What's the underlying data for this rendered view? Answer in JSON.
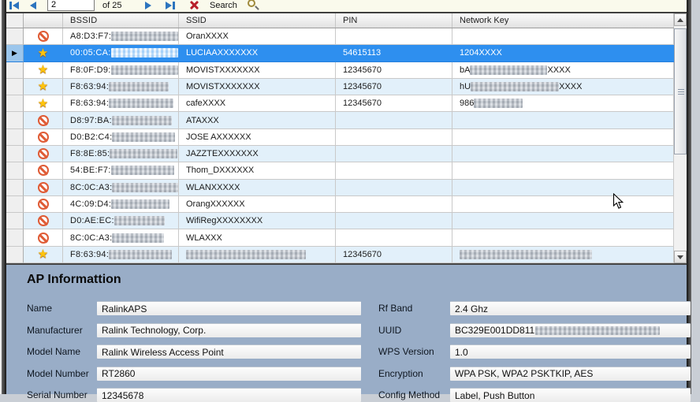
{
  "toolbar": {
    "record_value": "2",
    "of_label": "of 25",
    "search_label": "Search"
  },
  "table": {
    "columns": [
      "BSSID",
      "SSID",
      "PIN",
      "Network Key"
    ],
    "rows": [
      {
        "icon": "blocked",
        "selected": false,
        "bssid": [
          {
            "t": "A8:D3:F7:"
          },
          {
            "b": 90
          }
        ],
        "ssid": [
          {
            "t": "OranXXXX"
          }
        ],
        "pin": [],
        "key": []
      },
      {
        "icon": "star",
        "selected": true,
        "bssid": [
          {
            "t": "00:05:CA:"
          },
          {
            "b": 86
          }
        ],
        "ssid": [
          {
            "t": "LUCIAAXXXXXXX"
          }
        ],
        "pin": [
          {
            "t": "54615113"
          }
        ],
        "key": [
          {
            "t": "1204XXXX"
          }
        ]
      },
      {
        "icon": "star",
        "selected": false,
        "bssid": [
          {
            "t": "F8:0F:D9:"
          },
          {
            "b": 92
          }
        ],
        "ssid": [
          {
            "t": "MOVISTXXXXXXX"
          }
        ],
        "pin": [
          {
            "t": "12345670"
          }
        ],
        "key": [
          {
            "t": "bA"
          },
          {
            "b": 98
          },
          {
            "t": "XXXX"
          }
        ]
      },
      {
        "icon": "star",
        "selected": false,
        "bssid": [
          {
            "t": "F8:63:94:"
          },
          {
            "b": 76
          }
        ],
        "ssid": [
          {
            "t": "MOVISTXXXXXXX"
          }
        ],
        "pin": [
          {
            "t": "12345670"
          }
        ],
        "key": [
          {
            "t": "hU"
          },
          {
            "b": 112
          },
          {
            "t": "XXXX"
          }
        ]
      },
      {
        "icon": "star",
        "selected": false,
        "bssid": [
          {
            "t": "F8:63:94:"
          },
          {
            "b": 82
          }
        ],
        "ssid": [
          {
            "t": "cafeXXXX"
          }
        ],
        "pin": [
          {
            "t": "12345670"
          }
        ],
        "key": [
          {
            "t": "986"
          },
          {
            "b": 62
          }
        ]
      },
      {
        "icon": "blocked",
        "selected": false,
        "bssid": [
          {
            "t": "D8:97:BA:"
          },
          {
            "b": 76
          }
        ],
        "ssid": [
          {
            "t": "ATAXXX"
          }
        ],
        "pin": [],
        "key": []
      },
      {
        "icon": "blocked",
        "selected": false,
        "bssid": [
          {
            "t": "D0:B2:C4:"
          },
          {
            "b": 80
          }
        ],
        "ssid": [
          {
            "t": "JOSE AXXXXXX"
          }
        ],
        "pin": [],
        "key": []
      },
      {
        "icon": "blocked",
        "selected": false,
        "bssid": [
          {
            "t": "F8:8E:85:"
          },
          {
            "b": 86
          }
        ],
        "ssid": [
          {
            "t": "JAZZTEXXXXXXX"
          }
        ],
        "pin": [],
        "key": []
      },
      {
        "icon": "blocked",
        "selected": false,
        "bssid": [
          {
            "t": "54:BE:F7:"
          },
          {
            "b": 80
          }
        ],
        "ssid": [
          {
            "t": "Thom_DXXXXXX"
          }
        ],
        "pin": [],
        "key": []
      },
      {
        "icon": "blocked",
        "selected": false,
        "bssid": [
          {
            "t": "8C:0C:A3:"
          },
          {
            "b": 86
          }
        ],
        "ssid": [
          {
            "t": "WLANXXXXX"
          }
        ],
        "pin": [],
        "key": []
      },
      {
        "icon": "blocked",
        "selected": false,
        "bssid": [
          {
            "t": "4C:09:D4:"
          },
          {
            "b": 74
          }
        ],
        "ssid": [
          {
            "t": "OrangXXXXXX"
          }
        ],
        "pin": [],
        "key": []
      },
      {
        "icon": "blocked",
        "selected": false,
        "bssid": [
          {
            "t": "D0:AE:EC:"
          },
          {
            "b": 64
          }
        ],
        "ssid": [
          {
            "t": "WifiRegXXXXXXXX"
          }
        ],
        "pin": [],
        "key": []
      },
      {
        "icon": "blocked",
        "selected": false,
        "bssid": [
          {
            "t": "8C:0C:A3:"
          },
          {
            "b": 66
          }
        ],
        "ssid": [
          {
            "t": "WLAXXX"
          }
        ],
        "pin": [],
        "key": []
      },
      {
        "icon": "star",
        "selected": false,
        "bssid": [
          {
            "t": "F8:63:94:"
          },
          {
            "b": 80
          }
        ],
        "ssid": [
          {
            "b": 152
          }
        ],
        "pin": [
          {
            "t": "12345670"
          }
        ],
        "key": [
          {
            "b": 168
          }
        ]
      }
    ]
  },
  "ap_info": {
    "title": "AP Informattion",
    "left_fields": [
      {
        "label": "Name",
        "value": "RalinkAPS"
      },
      {
        "label": "Manufacturer",
        "value": "Ralink Technology, Corp."
      },
      {
        "label": "Model Name",
        "value": "Ralink Wireless Access Point"
      },
      {
        "label": "Model Number",
        "value": "RT2860"
      },
      {
        "label": "Serial Number",
        "value": "12345678"
      }
    ],
    "right_fields": [
      {
        "label": "Rf Band",
        "value": "2.4 Ghz"
      },
      {
        "label": "UUID",
        "value": "BC329E001DD811",
        "value_redacted": true,
        "redacted_width": 158
      },
      {
        "label": "WPS Version",
        "value": "1.0"
      },
      {
        "label": "Encryption",
        "value": "WPA PSK, WPA2 PSKTKIP, AES"
      },
      {
        "label": "Config Method",
        "value": "Label, Push Button"
      }
    ]
  },
  "colors": {
    "selection": "#2E8FEF",
    "row_alt": "#E2F0FA",
    "panel": "#99ADC7",
    "toolbar_bg": "#FAFAEC",
    "star": "#FFC40C",
    "blocked": "#DF5B35"
  }
}
